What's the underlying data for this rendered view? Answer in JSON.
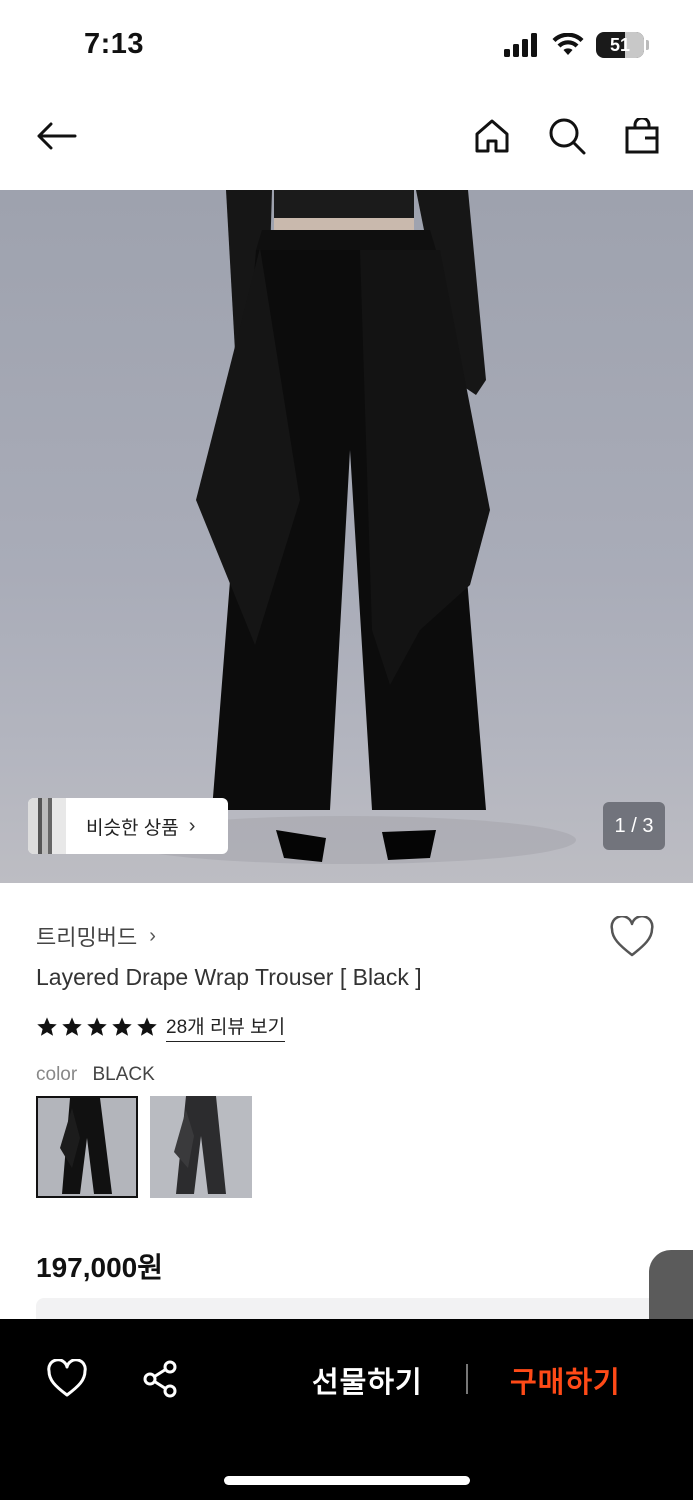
{
  "status_bar": {
    "time": "7:13",
    "battery": "51"
  },
  "header": {
    "back_icon": "arrow-left-icon",
    "home_icon": "home-icon",
    "search_icon": "search-icon",
    "bag_icon": "shopping-bag-icon"
  },
  "hero": {
    "similar_label": "비슷한 상품",
    "counter": "1 / 3"
  },
  "product": {
    "brand": "트리밍버드",
    "title": "Layered Drape Wrap Trouser [ Black ]",
    "rating_stars": 5,
    "review_link": "28개 리뷰 보기",
    "color_label": "color",
    "color_value": "BLACK",
    "price": "197,000원"
  },
  "bottom_bar": {
    "gift_label": "선물하기",
    "buy_label": "구매하기"
  },
  "colors": {
    "buy_accent": "#ff4a17",
    "background": "#ffffff",
    "bottom_bar": "#000000"
  }
}
